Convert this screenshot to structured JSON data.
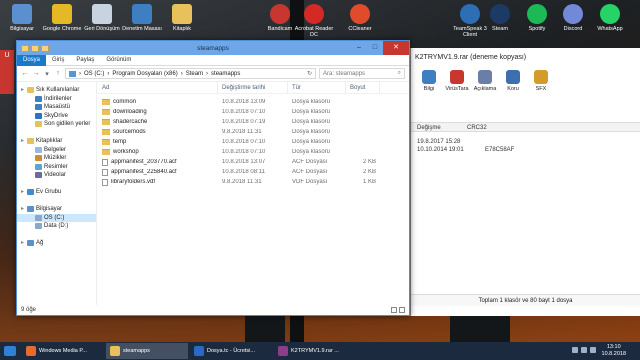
{
  "desktop": {
    "left_icons": [
      {
        "label": "Bilgisayar",
        "color": "#5a8fd0"
      },
      {
        "label": "Google Chrome",
        "color": "#e5b925"
      },
      {
        "label": "Geri Dönüşüm",
        "color": "#c7d3de"
      },
      {
        "label": "Denetim Masası",
        "color": "#3d7fc1"
      },
      {
        "label": "Kitaplık",
        "color": "#e9c15c"
      }
    ],
    "right_icons": [
      {
        "label": "Bandicam",
        "color": "#c7372f"
      },
      {
        "label": "Acrobat Reader DC",
        "color": "#d42a25"
      },
      {
        "label": "CCleaner",
        "color": "#e04b2b"
      },
      {
        "label": "TeamSpeak 3 Client",
        "color": "#2d6eb5"
      },
      {
        "label": "Steam",
        "color": "#1b3a66"
      },
      {
        "label": "Spotify",
        "color": "#1db954"
      },
      {
        "label": "Discord",
        "color": "#7289da"
      },
      {
        "label": "WhatsApp",
        "color": "#25d366"
      }
    ],
    "side_badge": "U"
  },
  "explorer": {
    "title": "steamapps",
    "ribbon_tabs": [
      "Dosya",
      "Giriş",
      "Paylaş",
      "Görünüm"
    ],
    "path": [
      "OS (C:)",
      "Program Dosyaları (x86)",
      "Steam",
      "steamapps"
    ],
    "search_placeholder": "Ara: steamapps",
    "columns": {
      "name": "Ad",
      "date": "Değiştirme tarihi",
      "type": "Tür",
      "size": "Boyut"
    },
    "files": [
      {
        "name": "common",
        "date": "10.8.2018 13:09",
        "type": "Dosya klasörü",
        "size": "",
        "kind": "folder"
      },
      {
        "name": "downloading",
        "date": "10.8.2018 07:10",
        "type": "Dosya klasörü",
        "size": "",
        "kind": "folder"
      },
      {
        "name": "shadercache",
        "date": "10.8.2018 07:19",
        "type": "Dosya klasörü",
        "size": "",
        "kind": "folder"
      },
      {
        "name": "sourcemods",
        "date": "9.8.2018 11:31",
        "type": "Dosya klasörü",
        "size": "",
        "kind": "folder"
      },
      {
        "name": "temp",
        "date": "10.8.2018 07:10",
        "type": "Dosya klasörü",
        "size": "",
        "kind": "folder"
      },
      {
        "name": "workshop",
        "date": "10.8.2018 07:10",
        "type": "Dosya klasörü",
        "size": "",
        "kind": "folder"
      },
      {
        "name": "appmanifest_203770.acf",
        "date": "10.8.2018 13:07",
        "type": "ACF Dosyası",
        "size": "2 KB",
        "kind": "file"
      },
      {
        "name": "appmanifest_225840.acf",
        "date": "10.8.2018 08:11",
        "type": "ACF Dosyası",
        "size": "2 KB",
        "kind": "file"
      },
      {
        "name": "libraryfolders.vdf",
        "date": "9.8.2018 11:31",
        "type": "VDF Dosyası",
        "size": "1 KB",
        "kind": "file"
      }
    ],
    "nav": [
      {
        "label": "Sık Kullanılanlar",
        "color": "#e8c15a",
        "indent": 0
      },
      {
        "label": "İndirilenler",
        "color": "#3d7fc1",
        "indent": 1
      },
      {
        "label": "Masaüstü",
        "color": "#3d7fc1",
        "indent": 1
      },
      {
        "label": "SkyDrive",
        "color": "#2a72c4",
        "indent": 1
      },
      {
        "label": "Son gidilen yerler",
        "color": "#e8c15a",
        "indent": 1
      },
      {
        "label": "",
        "color": "",
        "indent": 0
      },
      {
        "label": "Kitaplıklar",
        "color": "#e8c15a",
        "indent": 0
      },
      {
        "label": "Belgeler",
        "color": "#9ab8d8",
        "indent": 1
      },
      {
        "label": "Müzikler",
        "color": "#d28b2f",
        "indent": 1
      },
      {
        "label": "Resimler",
        "color": "#5fa3d9",
        "indent": 1
      },
      {
        "label": "Videolar",
        "color": "#6a6a9e",
        "indent": 1
      },
      {
        "label": "",
        "color": "",
        "indent": 0
      },
      {
        "label": "Ev Grubu",
        "color": "#3c8fd6",
        "indent": 0
      },
      {
        "label": "",
        "color": "",
        "indent": 0
      },
      {
        "label": "Bilgisayar",
        "color": "#5a8fd0",
        "indent": 0
      },
      {
        "label": "OS (C:)",
        "color": "#8aa8c8",
        "indent": 1,
        "selected": true
      },
      {
        "label": "Data (D:)",
        "color": "#8aa8c8",
        "indent": 1
      },
      {
        "label": "",
        "color": "",
        "indent": 0
      },
      {
        "label": "Ağ",
        "color": "#5a8fd0",
        "indent": 0
      }
    ],
    "status": "9 öğe"
  },
  "archive": {
    "title": "K2TRYMV1.9.rar (deneme kopyası)",
    "tools": [
      {
        "label": "Bilgi",
        "color": "#3d7fc1"
      },
      {
        "label": "VirüsTara",
        "color": "#c7372f"
      },
      {
        "label": "Açıklama",
        "color": "#6a7fa8"
      },
      {
        "label": "Koru",
        "color": "#3d6fb0"
      },
      {
        "label": "SFX",
        "color": "#d59b2a"
      }
    ],
    "columns": [
      "Değişme",
      "CRC32"
    ],
    "rows": [
      [
        "19.8.2017 15:28",
        ""
      ],
      [
        "10.10.2014 19:01",
        "E78C58AF"
      ]
    ],
    "status": "Toplam 1 klasör ve 80 bayt 1 dosya"
  },
  "taskbar": {
    "items": [
      {
        "label": "Windows Media P...",
        "color": "#e66c2c"
      },
      {
        "label": "steamapps",
        "color": "#e8c15a",
        "active": true
      },
      {
        "label": "Dosya.tc - Ücretsi...",
        "color": "#2a6ac4"
      },
      {
        "label": "K2TRYMV1.9.rar ...",
        "color": "#8c3d8c"
      }
    ],
    "time": "13:10",
    "date": "10.8.2018"
  }
}
